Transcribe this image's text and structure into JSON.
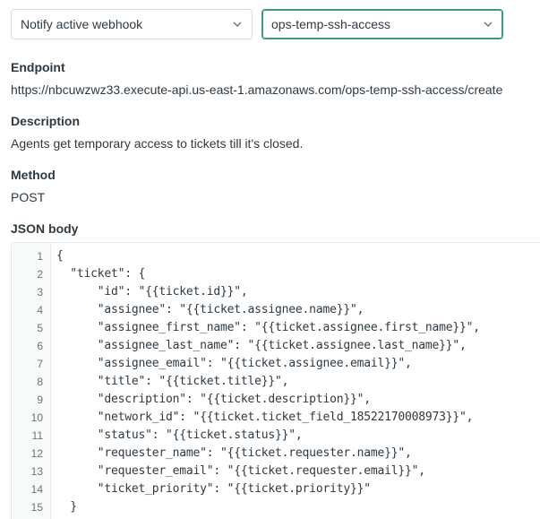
{
  "selects": {
    "webhook": {
      "value": "Notify active webhook",
      "icon": "chevron-down-icon"
    },
    "target": {
      "value": "ops-temp-ssh-access",
      "icon": "chevron-down-icon"
    }
  },
  "endpoint": {
    "label": "Endpoint",
    "value": "https://nbcuwzwz33.execute-api.us-east-1.amazonaws.com/ops-temp-ssh-access/create"
  },
  "description": {
    "label": "Description",
    "value": "Agents get temporary access to tickets till it's closed."
  },
  "method": {
    "label": "Method",
    "value": "POST"
  },
  "json_body": {
    "label": "JSON body",
    "line_numbers": [
      "1",
      "2",
      "3",
      "4",
      "5",
      "6",
      "7",
      "8",
      "9",
      "10",
      "11",
      "12",
      "13",
      "14",
      "15"
    ],
    "lines": [
      "{",
      "  \"ticket\": {",
      "      \"id\": \"{{ticket.id}}\",",
      "      \"assignee\": \"{{ticket.assignee.name}}\",",
      "      \"assignee_first_name\": \"{{ticket.assignee.first_name}}\",",
      "      \"assignee_last_name\": \"{{ticket.assignee.last_name}}\",",
      "      \"assignee_email\": \"{{ticket.assignee.email}}\",",
      "      \"title\": \"{{ticket.title}}\",",
      "      \"description\": \"{{ticket.description}}\",",
      "      \"network_id\": \"{{ticket.ticket_field_18522170008973}}\",",
      "      \"status\": \"{{ticket.status}}\",",
      "      \"requester_name\": \"{{ticket.requester.name}}\",",
      "      \"requester_email\": \"{{ticket.requester.email}}\",",
      "      \"ticket_priority\": \"{{ticket.priority}}\"",
      "  }"
    ]
  }
}
